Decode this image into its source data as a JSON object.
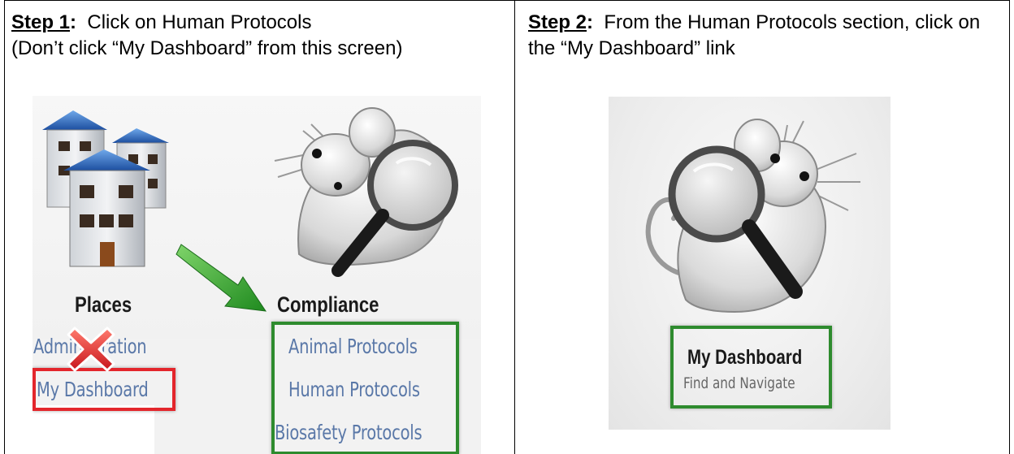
{
  "step1": {
    "label": "Step 1",
    "colon": ":",
    "line1": "Click on Human Protocols",
    "line2": "(Don’t click “My Dashboard” from this screen)"
  },
  "step2": {
    "label": "Step 2",
    "colon": ":",
    "text": "From the Human Protocols section, click on the “My Dashboard” link"
  },
  "left_screen": {
    "places_heading": "Places",
    "compliance_heading": "Compliance",
    "administration_link": "Administration",
    "my_dashboard_link": "My Dashboard",
    "animal_protocols_link": "Animal Protocols",
    "human_protocols_link": "Human Protocols",
    "biosafety_protocols_link": "Biosafety Protocols",
    "icons": [
      "buildings-icon",
      "mouse-magnifier-icon",
      "arrow-icon",
      "x-mark-icon"
    ],
    "colors": {
      "red_box": "#e3262c",
      "green_box": "#2e8b2e",
      "link": "#5a78a8",
      "arrow": "#3aa832"
    }
  },
  "right_screen": {
    "dashboard_title": "My Dashboard",
    "dashboard_subtitle": "Find and Navigate",
    "icons": [
      "mouse-magnifier-icon"
    ]
  }
}
